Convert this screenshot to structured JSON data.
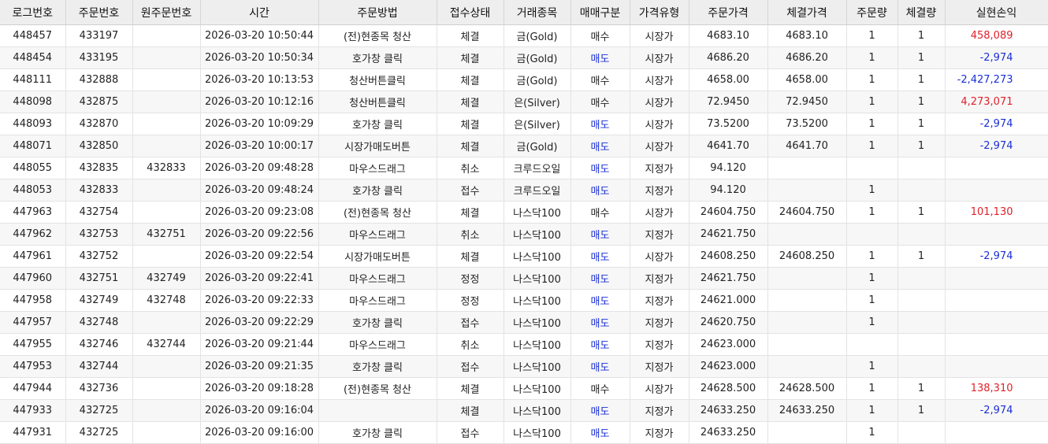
{
  "colors": {
    "sell": "#1a2fd6",
    "profit": "#e0202a",
    "loss": "#1a2fd6",
    "header_bg": "#eeeeee"
  },
  "headers": [
    "로그번호",
    "주문번호",
    "원주문번호",
    "시간",
    "주문방법",
    "접수상태",
    "거래종목",
    "매매구분",
    "가격유형",
    "주문가격",
    "체결가격",
    "주문량",
    "체결량",
    "실현손익"
  ],
  "rows": [
    [
      "448457",
      "433197",
      "",
      "2026-03-20 10:50:44",
      "(전)현종목 청산",
      "체결",
      "금(Gold)",
      "매수",
      "시장가",
      "4683.10",
      "4683.10",
      "1",
      "1",
      "458,089"
    ],
    [
      "448454",
      "433195",
      "",
      "2026-03-20 10:50:34",
      "호가창 클릭",
      "체결",
      "금(Gold)",
      "매도",
      "시장가",
      "4686.20",
      "4686.20",
      "1",
      "1",
      "-2,974"
    ],
    [
      "448111",
      "432888",
      "",
      "2026-03-20 10:13:53",
      "청산버튼클릭",
      "체결",
      "금(Gold)",
      "매수",
      "시장가",
      "4658.00",
      "4658.00",
      "1",
      "1",
      "-2,427,273"
    ],
    [
      "448098",
      "432875",
      "",
      "2026-03-20 10:12:16",
      "청산버튼클릭",
      "체결",
      "은(Silver)",
      "매수",
      "시장가",
      "72.9450",
      "72.9450",
      "1",
      "1",
      "4,273,071"
    ],
    [
      "448093",
      "432870",
      "",
      "2026-03-20 10:09:29",
      "호가창 클릭",
      "체결",
      "은(Silver)",
      "매도",
      "시장가",
      "73.5200",
      "73.5200",
      "1",
      "1",
      "-2,974"
    ],
    [
      "448071",
      "432850",
      "",
      "2026-03-20 10:00:17",
      "시장가매도버튼",
      "체결",
      "금(Gold)",
      "매도",
      "시장가",
      "4641.70",
      "4641.70",
      "1",
      "1",
      "-2,974"
    ],
    [
      "448055",
      "432835",
      "432833",
      "2026-03-20 09:48:28",
      "마우스드래그",
      "취소",
      "크루드오일",
      "매도",
      "지정가",
      "94.120",
      "",
      "",
      "",
      ""
    ],
    [
      "448053",
      "432833",
      "",
      "2026-03-20 09:48:24",
      "호가창 클릭",
      "접수",
      "크루드오일",
      "매도",
      "지정가",
      "94.120",
      "",
      "1",
      "",
      ""
    ],
    [
      "447963",
      "432754",
      "",
      "2026-03-20 09:23:08",
      "(전)현종목 청산",
      "체결",
      "나스닥100",
      "매수",
      "시장가",
      "24604.750",
      "24604.750",
      "1",
      "1",
      "101,130"
    ],
    [
      "447962",
      "432753",
      "432751",
      "2026-03-20 09:22:56",
      "마우스드래그",
      "취소",
      "나스닥100",
      "매도",
      "지정가",
      "24621.750",
      "",
      "",
      "",
      ""
    ],
    [
      "447961",
      "432752",
      "",
      "2026-03-20 09:22:54",
      "시장가매도버튼",
      "체결",
      "나스닥100",
      "매도",
      "시장가",
      "24608.250",
      "24608.250",
      "1",
      "1",
      "-2,974"
    ],
    [
      "447960",
      "432751",
      "432749",
      "2026-03-20 09:22:41",
      "마우스드래그",
      "정정",
      "나스닥100",
      "매도",
      "지정가",
      "24621.750",
      "",
      "1",
      "",
      ""
    ],
    [
      "447958",
      "432749",
      "432748",
      "2026-03-20 09:22:33",
      "마우스드래그",
      "정정",
      "나스닥100",
      "매도",
      "지정가",
      "24621.000",
      "",
      "1",
      "",
      ""
    ],
    [
      "447957",
      "432748",
      "",
      "2026-03-20 09:22:29",
      "호가창 클릭",
      "접수",
      "나스닥100",
      "매도",
      "지정가",
      "24620.750",
      "",
      "1",
      "",
      ""
    ],
    [
      "447955",
      "432746",
      "432744",
      "2026-03-20 09:21:44",
      "마우스드래그",
      "취소",
      "나스닥100",
      "매도",
      "지정가",
      "24623.000",
      "",
      "",
      "",
      ""
    ],
    [
      "447953",
      "432744",
      "",
      "2026-03-20 09:21:35",
      "호가창 클릭",
      "접수",
      "나스닥100",
      "매도",
      "지정가",
      "24623.000",
      "",
      "1",
      "",
      ""
    ],
    [
      "447944",
      "432736",
      "",
      "2026-03-20 09:18:28",
      "(전)현종목 청산",
      "체결",
      "나스닥100",
      "매수",
      "시장가",
      "24628.500",
      "24628.500",
      "1",
      "1",
      "138,310"
    ],
    [
      "447933",
      "432725",
      "",
      "2026-03-20 09:16:04",
      "",
      "체결",
      "나스닥100",
      "매도",
      "지정가",
      "24633.250",
      "24633.250",
      "1",
      "1",
      "-2,974"
    ],
    [
      "447931",
      "432725",
      "",
      "2026-03-20 09:16:00",
      "호가창 클릭",
      "접수",
      "나스닥100",
      "매도",
      "지정가",
      "24633.250",
      "",
      "1",
      "",
      ""
    ]
  ]
}
